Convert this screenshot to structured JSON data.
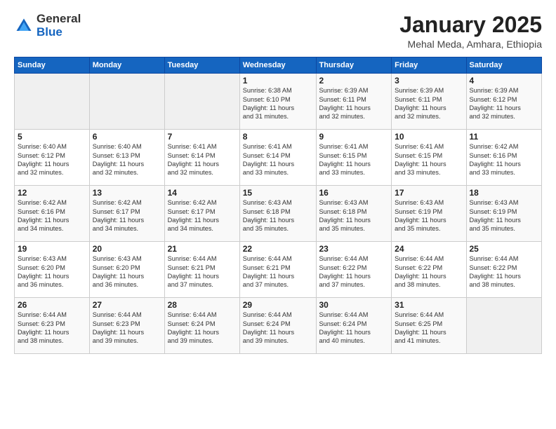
{
  "logo": {
    "general": "General",
    "blue": "Blue"
  },
  "title": "January 2025",
  "subtitle": "Mehal Meda, Amhara, Ethiopia",
  "days_of_week": [
    "Sunday",
    "Monday",
    "Tuesday",
    "Wednesday",
    "Thursday",
    "Friday",
    "Saturday"
  ],
  "weeks": [
    [
      {
        "day": "",
        "info": ""
      },
      {
        "day": "",
        "info": ""
      },
      {
        "day": "",
        "info": ""
      },
      {
        "day": "1",
        "info": "Sunrise: 6:38 AM\nSunset: 6:10 PM\nDaylight: 11 hours\nand 31 minutes."
      },
      {
        "day": "2",
        "info": "Sunrise: 6:39 AM\nSunset: 6:11 PM\nDaylight: 11 hours\nand 32 minutes."
      },
      {
        "day": "3",
        "info": "Sunrise: 6:39 AM\nSunset: 6:11 PM\nDaylight: 11 hours\nand 32 minutes."
      },
      {
        "day": "4",
        "info": "Sunrise: 6:39 AM\nSunset: 6:12 PM\nDaylight: 11 hours\nand 32 minutes."
      }
    ],
    [
      {
        "day": "5",
        "info": "Sunrise: 6:40 AM\nSunset: 6:12 PM\nDaylight: 11 hours\nand 32 minutes."
      },
      {
        "day": "6",
        "info": "Sunrise: 6:40 AM\nSunset: 6:13 PM\nDaylight: 11 hours\nand 32 minutes."
      },
      {
        "day": "7",
        "info": "Sunrise: 6:41 AM\nSunset: 6:14 PM\nDaylight: 11 hours\nand 32 minutes."
      },
      {
        "day": "8",
        "info": "Sunrise: 6:41 AM\nSunset: 6:14 PM\nDaylight: 11 hours\nand 33 minutes."
      },
      {
        "day": "9",
        "info": "Sunrise: 6:41 AM\nSunset: 6:15 PM\nDaylight: 11 hours\nand 33 minutes."
      },
      {
        "day": "10",
        "info": "Sunrise: 6:41 AM\nSunset: 6:15 PM\nDaylight: 11 hours\nand 33 minutes."
      },
      {
        "day": "11",
        "info": "Sunrise: 6:42 AM\nSunset: 6:16 PM\nDaylight: 11 hours\nand 33 minutes."
      }
    ],
    [
      {
        "day": "12",
        "info": "Sunrise: 6:42 AM\nSunset: 6:16 PM\nDaylight: 11 hours\nand 34 minutes."
      },
      {
        "day": "13",
        "info": "Sunrise: 6:42 AM\nSunset: 6:17 PM\nDaylight: 11 hours\nand 34 minutes."
      },
      {
        "day": "14",
        "info": "Sunrise: 6:42 AM\nSunset: 6:17 PM\nDaylight: 11 hours\nand 34 minutes."
      },
      {
        "day": "15",
        "info": "Sunrise: 6:43 AM\nSunset: 6:18 PM\nDaylight: 11 hours\nand 35 minutes."
      },
      {
        "day": "16",
        "info": "Sunrise: 6:43 AM\nSunset: 6:18 PM\nDaylight: 11 hours\nand 35 minutes."
      },
      {
        "day": "17",
        "info": "Sunrise: 6:43 AM\nSunset: 6:19 PM\nDaylight: 11 hours\nand 35 minutes."
      },
      {
        "day": "18",
        "info": "Sunrise: 6:43 AM\nSunset: 6:19 PM\nDaylight: 11 hours\nand 35 minutes."
      }
    ],
    [
      {
        "day": "19",
        "info": "Sunrise: 6:43 AM\nSunset: 6:20 PM\nDaylight: 11 hours\nand 36 minutes."
      },
      {
        "day": "20",
        "info": "Sunrise: 6:43 AM\nSunset: 6:20 PM\nDaylight: 11 hours\nand 36 minutes."
      },
      {
        "day": "21",
        "info": "Sunrise: 6:44 AM\nSunset: 6:21 PM\nDaylight: 11 hours\nand 37 minutes."
      },
      {
        "day": "22",
        "info": "Sunrise: 6:44 AM\nSunset: 6:21 PM\nDaylight: 11 hours\nand 37 minutes."
      },
      {
        "day": "23",
        "info": "Sunrise: 6:44 AM\nSunset: 6:22 PM\nDaylight: 11 hours\nand 37 minutes."
      },
      {
        "day": "24",
        "info": "Sunrise: 6:44 AM\nSunset: 6:22 PM\nDaylight: 11 hours\nand 38 minutes."
      },
      {
        "day": "25",
        "info": "Sunrise: 6:44 AM\nSunset: 6:22 PM\nDaylight: 11 hours\nand 38 minutes."
      }
    ],
    [
      {
        "day": "26",
        "info": "Sunrise: 6:44 AM\nSunset: 6:23 PM\nDaylight: 11 hours\nand 38 minutes."
      },
      {
        "day": "27",
        "info": "Sunrise: 6:44 AM\nSunset: 6:23 PM\nDaylight: 11 hours\nand 39 minutes."
      },
      {
        "day": "28",
        "info": "Sunrise: 6:44 AM\nSunset: 6:24 PM\nDaylight: 11 hours\nand 39 minutes."
      },
      {
        "day": "29",
        "info": "Sunrise: 6:44 AM\nSunset: 6:24 PM\nDaylight: 11 hours\nand 39 minutes."
      },
      {
        "day": "30",
        "info": "Sunrise: 6:44 AM\nSunset: 6:24 PM\nDaylight: 11 hours\nand 40 minutes."
      },
      {
        "day": "31",
        "info": "Sunrise: 6:44 AM\nSunset: 6:25 PM\nDaylight: 11 hours\nand 41 minutes."
      },
      {
        "day": "",
        "info": ""
      }
    ]
  ]
}
